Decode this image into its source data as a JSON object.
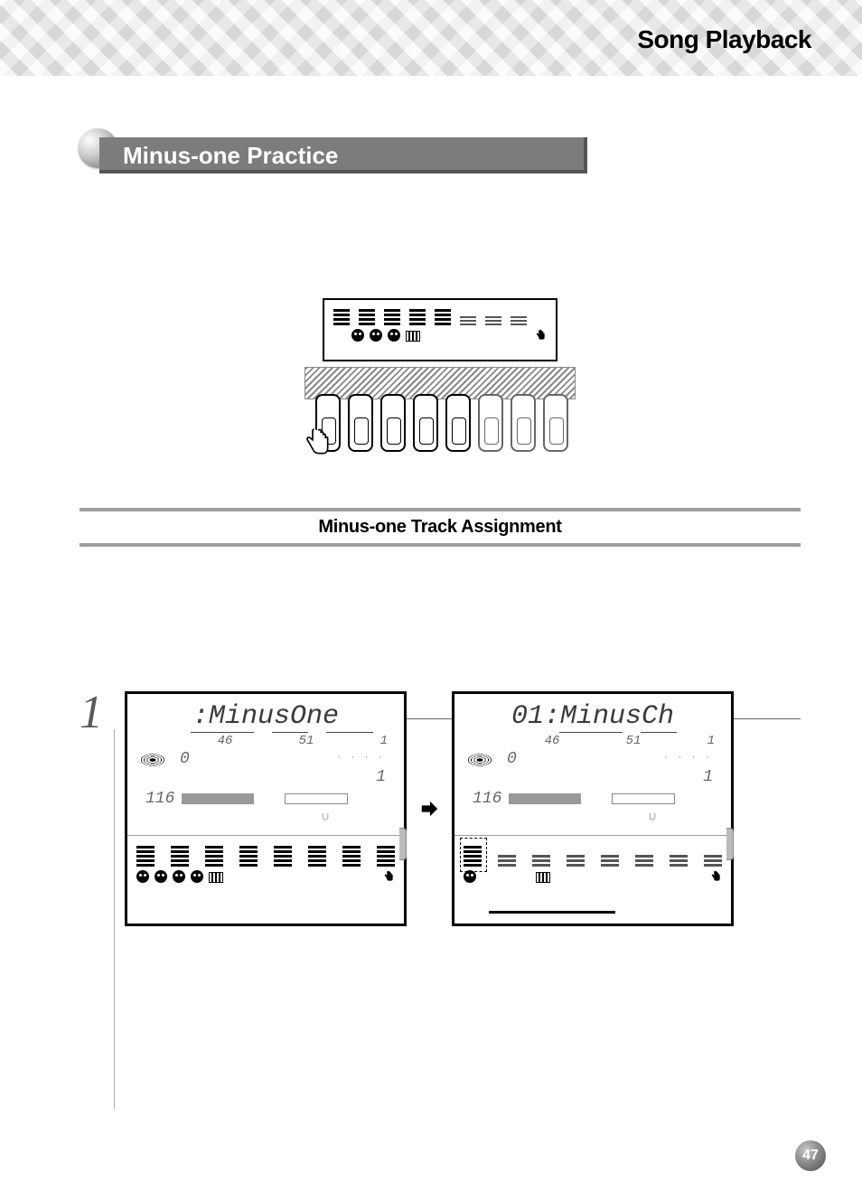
{
  "header": {
    "title": "Song Playback"
  },
  "section": {
    "title": "Minus-one Practice"
  },
  "subsection": {
    "title": "Minus-one Track Assignment"
  },
  "step": {
    "number": "1"
  },
  "panel_left": {
    "title": ":MinusOne",
    "n1": "46",
    "n2": "51",
    "n3": "1",
    "transpose": "0",
    "measure": "1",
    "tempo": "116"
  },
  "panel_right": {
    "title": "01:MinusCh",
    "n1": "46",
    "n2": "51",
    "n3": "1",
    "transpose": "0",
    "measure": "1",
    "tempo": "116"
  },
  "page": {
    "number": "47"
  }
}
